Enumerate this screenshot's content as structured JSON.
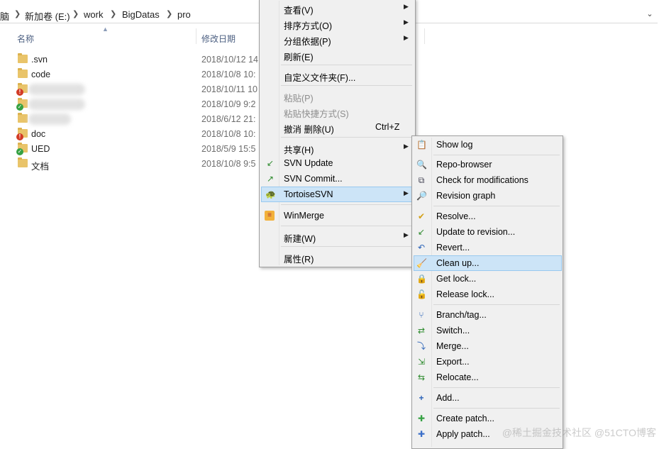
{
  "breadcrumb": [
    "脑",
    "新加卷 (E:)",
    "work",
    "BigDatas",
    "pro"
  ],
  "columns": {
    "name": "名称",
    "modified": "修改日期"
  },
  "files": [
    {
      "name": ".svn",
      "date": "2018/10/12 14",
      "overlay": "none"
    },
    {
      "name": "code",
      "date": "2018/10/8 10:",
      "overlay": "none"
    },
    {
      "name": "",
      "date": "2018/10/11 10",
      "overlay": "red"
    },
    {
      "name": "",
      "date": "2018/10/9 9:2",
      "overlay": "green"
    },
    {
      "name": "",
      "date": "2018/6/12 21:",
      "overlay": "none"
    },
    {
      "name": "doc",
      "date": "2018/10/8 10:",
      "overlay": "red"
    },
    {
      "name": "UED",
      "date": "2018/5/9 15:5",
      "overlay": "green"
    },
    {
      "name": "文档",
      "date": "2018/10/8 9:5",
      "overlay": "none"
    }
  ],
  "context_menu": {
    "view": "查看(V)",
    "sort_by": "排序方式(O)",
    "group_by": "分组依据(P)",
    "refresh": "刷新(E)",
    "customize": "自定义文件夹(F)...",
    "paste": "粘贴(P)",
    "paste_shortcut": "粘贴快捷方式(S)",
    "undo_delete": "撤消 删除(U)",
    "undo_shortcut": "Ctrl+Z",
    "share": "共享(H)",
    "svn_update": "SVN Update",
    "svn_commit": "SVN Commit...",
    "tortoise": "TortoiseSVN",
    "winmerge": "WinMerge",
    "new": "新建(W)",
    "properties": "属性(R)"
  },
  "svn_menu": {
    "show_log": "Show log",
    "repo_browser": "Repo-browser",
    "check_mods": "Check for modifications",
    "revision_graph": "Revision graph",
    "resolve": "Resolve...",
    "update_to_rev": "Update to revision...",
    "revert": "Revert...",
    "clean_up": "Clean up...",
    "get_lock": "Get lock...",
    "release_lock": "Release lock...",
    "branch_tag": "Branch/tag...",
    "switch": "Switch...",
    "merge": "Merge...",
    "export": "Export...",
    "relocate": "Relocate...",
    "add": "Add...",
    "create_patch": "Create patch...",
    "apply_patch": "Apply patch..."
  },
  "watermark": "@稀土掘金技术社区 @51CTO博客"
}
